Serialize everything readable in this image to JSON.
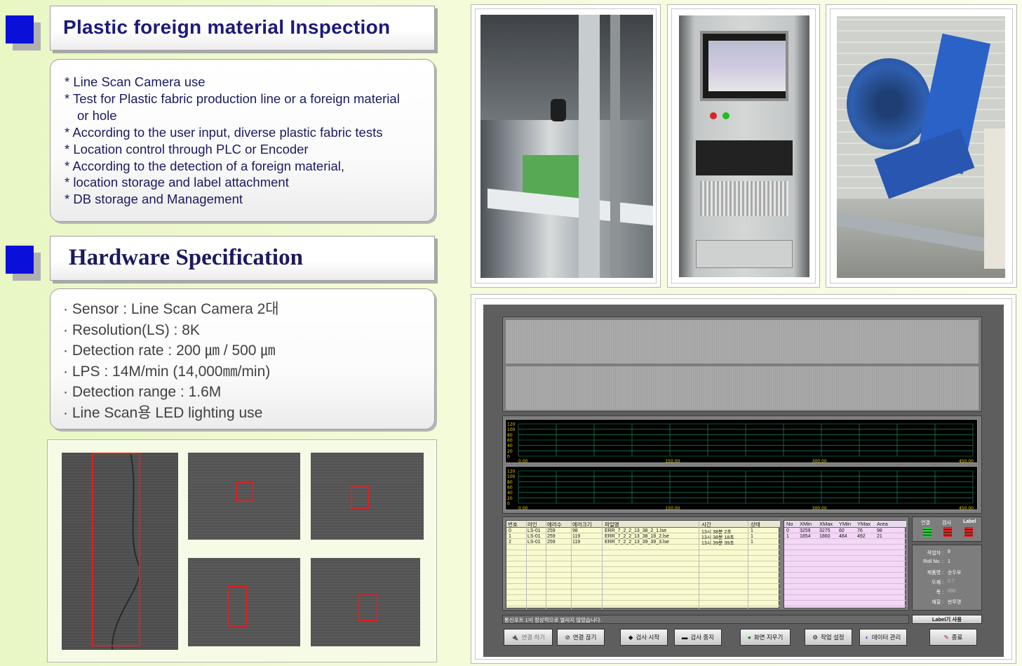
{
  "section1": {
    "title": "Plastic foreign material Inspection",
    "features": [
      "* Line Scan Camera use",
      "* Test for Plastic fabric production line or a foreign material",
      "or hole",
      "* According to the user input, diverse plastic fabric tests",
      "* Location control through PLC or Encoder",
      "* According to the detection of a foreign material,",
      "* location storage and label attachment",
      "* DB storage and Management"
    ]
  },
  "section2": {
    "title": "Hardware Specification",
    "specs": [
      "· Sensor : Line Scan Camera 2대",
      "· Resolution(LS)  : 8K",
      "· Detection rate  : 200 ㎛ / 500 ㎛",
      "· LPS : 14M/min (14,000㎜/min)",
      "· Detection range : 1.6M",
      "· Line Scan용 LED lighting use"
    ]
  },
  "software": {
    "graph1": {
      "y_ticks": [
        "120",
        "100",
        "80",
        "60",
        "40",
        "20",
        "0"
      ],
      "x_ticks": [
        "0.00",
        "150.00",
        "300.00",
        "450.00"
      ]
    },
    "graph2": {
      "y_ticks": [
        "120",
        "100",
        "80",
        "60",
        "40",
        "20",
        "0"
      ],
      "x_ticks": [
        "0.00",
        "150.00",
        "300.00",
        "450.00"
      ]
    },
    "table1": {
      "headers": [
        "번호",
        "라인",
        "에러수",
        "에러크기",
        "파일명",
        "시간",
        "상태"
      ],
      "rows": [
        [
          "0",
          "LS-01",
          "259",
          "98",
          "ERR_7_2_2_13_38_2_1.lse",
          "13시 38분 2초",
          "1"
        ],
        [
          "1",
          "LS-01",
          "259",
          "119",
          "ERR_7_2_2_13_38_18_2.lse",
          "13시 38분 18초",
          "1"
        ],
        [
          "2",
          "LS-01",
          "259",
          "119",
          "ERR_7_2_2_13_39_39_3.lse",
          "13시 39분 39초",
          "1"
        ]
      ]
    },
    "table2": {
      "headers": [
        "No",
        "XMin",
        "XMax",
        "YMin",
        "YMax",
        "Area"
      ],
      "rows": [
        [
          "0",
          "3259",
          "3275",
          "60",
          "76",
          "98"
        ],
        [
          "1",
          "1854",
          "1860",
          "484",
          "492",
          "21"
        ]
      ]
    },
    "status_panel": {
      "headers": [
        "연결",
        "검사",
        "Label"
      ],
      "colors": [
        "#22cc33",
        "#dd2222",
        "#dd2222"
      ]
    },
    "info_panel": {
      "rows": [
        {
          "label": "작업자 :",
          "value": "8"
        },
        {
          "label": "Roll No. :",
          "value": "1"
        },
        {
          "label": "제품명 :",
          "value": "순두부"
        },
        {
          "label": "두께 :",
          "value": "0.7"
        },
        {
          "label": "폭 :",
          "value": "890"
        },
        {
          "label": "재질 :",
          "value": "반투명"
        }
      ]
    },
    "label_button": "Label기 사용",
    "status_message": "통신포트 1이 정상적으로 열리지 않았습니다.",
    "buttons": [
      "연결 하기",
      "연결 끊기",
      "검사 시작",
      "검사 중지",
      "화면 지우기",
      "작업 설정",
      "데이터 관리",
      "종료"
    ],
    "colors": {
      "grid": "#1aa06a",
      "axis_text": "#e0d000"
    }
  }
}
